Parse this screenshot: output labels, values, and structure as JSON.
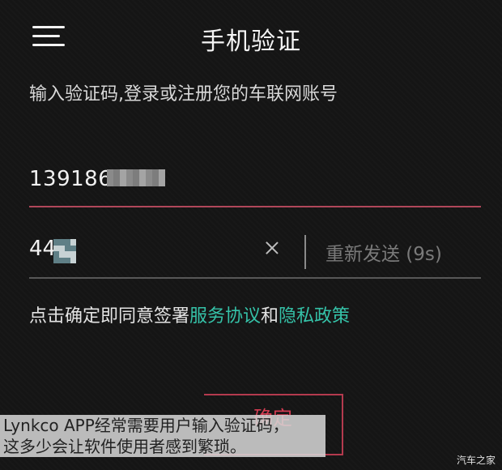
{
  "header": {
    "title": "手机验证",
    "menu_icon": "hamburger-menu-icon"
  },
  "hint": "输入验证码,登录或注册您的车联网账号",
  "phone": {
    "value": "139186",
    "mosaic_icon": "pixelated-redaction"
  },
  "code": {
    "value": "44",
    "clear_icon": "close-x-icon",
    "resend_label": "重新发送 (9s)"
  },
  "agreement": {
    "prefix": "点击确定即同意签署",
    "service_link": "服务协议",
    "conjunction": "和",
    "privacy_link": "隐私政策"
  },
  "confirm": {
    "label": "确定"
  },
  "caption": {
    "line1": "Lynkco APP经常需要用户输入验证码，",
    "line2": "这多少会让软件使用者感到繁琐。"
  },
  "watermark": "汽车之家",
  "colors": {
    "background": "#151515",
    "accent_red": "#b43a4e",
    "link_teal": "#35c2a8",
    "muted_gray": "#7a7a7a"
  }
}
